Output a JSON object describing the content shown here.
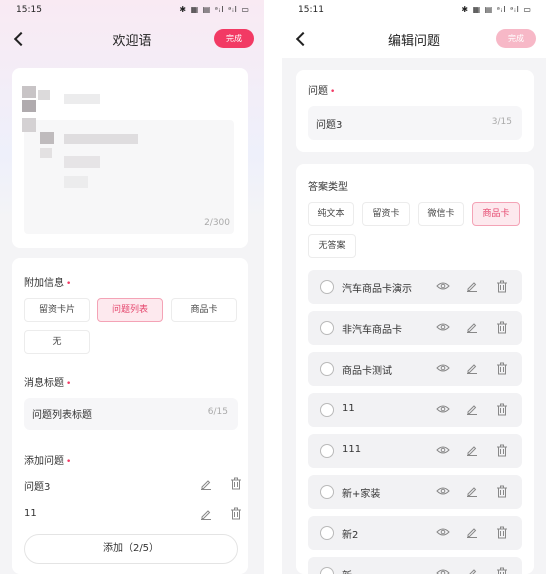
{
  "left": {
    "status_time": "15:15",
    "status_icons": "✱ ▦ ▤ ᵃᵢl ᵃᵢl ▭",
    "title": "欢迎语",
    "done_label": "完成",
    "message_counter": "2/300",
    "attach_label": "附加信息",
    "attach_options": [
      "留资卡片",
      "问题列表",
      "商品卡",
      "无"
    ],
    "attach_selected": "问题列表",
    "msg_title_label": "消息标题",
    "msg_title_value": "问题列表标题",
    "msg_title_counter": "6/15",
    "add_q_label": "添加问题",
    "questions": [
      "问题3",
      "11"
    ],
    "add_button": "添加（2/5）",
    "required_mark": "•"
  },
  "right": {
    "status_time": "15:11",
    "status_icons": "✱ ▦ ▤ ᵃᵢl ᵃᵢl ▭",
    "title": "编辑问题",
    "done_label": "完成",
    "question_label": "问题",
    "question_value": "问题3",
    "question_counter": "3/15",
    "answer_type_label": "答案类型",
    "answer_types": [
      "纯文本",
      "留资卡",
      "微信卡",
      "商品卡",
      "无答案"
    ],
    "answer_type_selected": "商品卡",
    "cards": [
      "汽车商品卡演示",
      "非汽车商品卡",
      "商品卡测试",
      "11",
      "111",
      "新+家装",
      "新2",
      "新"
    ],
    "required_mark": "•"
  },
  "colors": {
    "accent": "#f23a64",
    "accent_disabled": "#f7b8c7",
    "selected_bg": "#fde9ee"
  }
}
